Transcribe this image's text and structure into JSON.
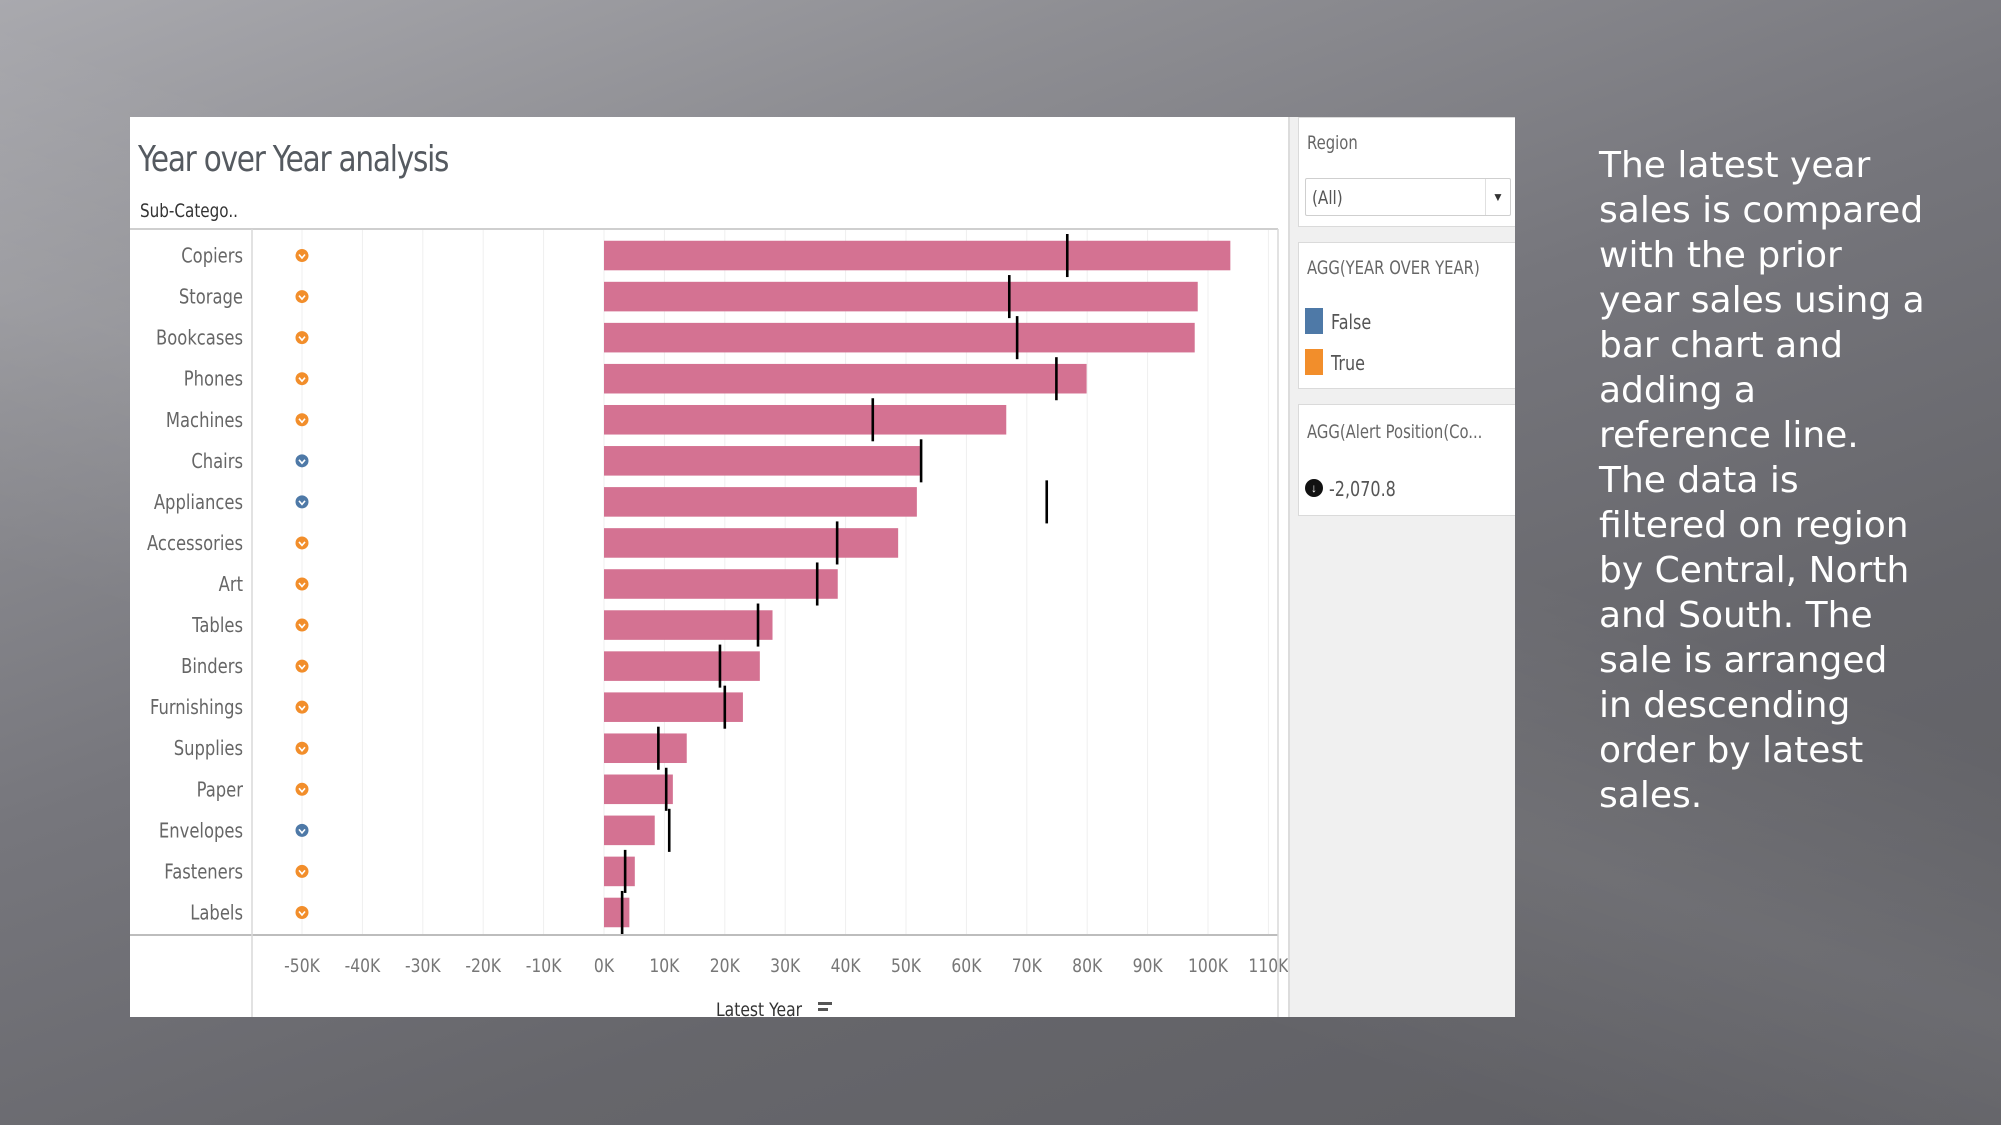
{
  "chart_data": {
    "type": "bar",
    "orientation": "horizontal",
    "title": "Year over Year analysis",
    "row_header": "Sub-Catego..",
    "xlabel": "Latest Year",
    "ylabel": "Sub-Category",
    "xlim": [
      -55000,
      112000
    ],
    "x_ticks": [
      -50000,
      -40000,
      -30000,
      -20000,
      -10000,
      0,
      10000,
      20000,
      30000,
      40000,
      50000,
      60000,
      70000,
      80000,
      90000,
      100000,
      110000
    ],
    "x_tick_labels": [
      "-50K",
      "-40K",
      "-30K",
      "-20K",
      "-10K",
      "0K",
      "10K",
      "20K",
      "30K",
      "40K",
      "50K",
      "60K",
      "70K",
      "80K",
      "90K",
      "100K",
      "110K"
    ],
    "grid": true,
    "categories": [
      "Copiers",
      "Storage",
      "Bookcases",
      "Phones",
      "Machines",
      "Chairs",
      "Appliances",
      "Accessories",
      "Art",
      "Tables",
      "Binders",
      "Furnishings",
      "Supplies",
      "Paper",
      "Envelopes",
      "Fasteners",
      "Labels"
    ],
    "series": [
      {
        "name": "Latest Year",
        "mark": "bar",
        "color": "#d47292",
        "values": [
          103700,
          98300,
          97800,
          79900,
          66600,
          52300,
          51800,
          48700,
          38700,
          27900,
          25800,
          23000,
          13700,
          11400,
          8400,
          5100,
          4200
        ]
      },
      {
        "name": "Prior Year",
        "mark": "reference-line",
        "color": "#000000",
        "values": [
          76700,
          67100,
          68400,
          74900,
          44500,
          52500,
          73300,
          38600,
          35300,
          25500,
          19200,
          20000,
          9000,
          10300,
          10800,
          3500,
          3000
        ]
      },
      {
        "name": "Alert Position",
        "mark": "circle-arrow-icon",
        "x_value": -50000,
        "color_by": "AGG(YEAR OVER YEAR)",
        "values": [
          true,
          true,
          true,
          true,
          true,
          false,
          false,
          true,
          true,
          true,
          true,
          true,
          true,
          true,
          false,
          true,
          true
        ]
      }
    ],
    "legend": {
      "title": "AGG(YEAR OVER YEAR)",
      "placement": "right",
      "items": [
        {
          "label": "False",
          "color": "#4e79a7"
        },
        {
          "label": "True",
          "color": "#f28e2b"
        }
      ]
    }
  },
  "filter": {
    "title": "Region",
    "selected": "(All)"
  },
  "alert_legend": {
    "title": "AGG(Alert Position(Co...",
    "icon": "down-arrow-circle-icon",
    "value": "-2,070.8"
  },
  "caption": "The latest year\nsales is compared\nwith the prior\nyear sales using a\nbar chart and\nadding a\nreference line.\nThe data is\nfiltered on region\nby  Central, North\nand South. The\nsale is arranged\nin descending\norder by latest\nsales."
}
